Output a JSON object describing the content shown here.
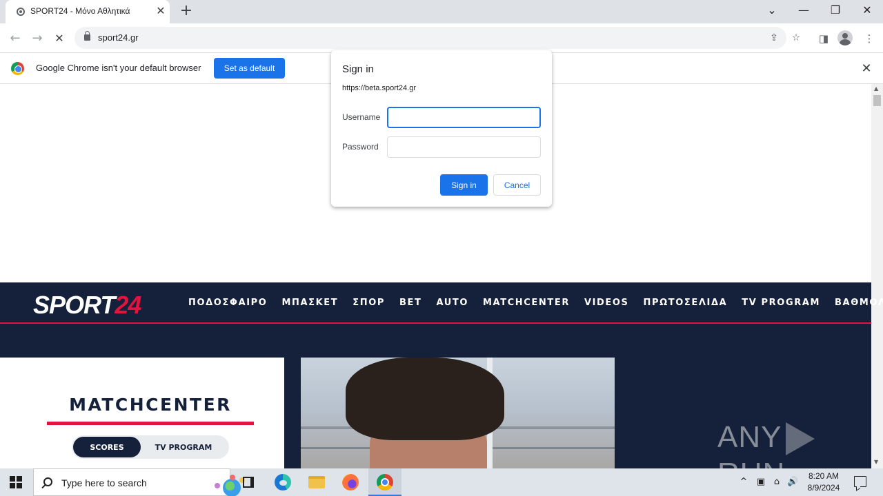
{
  "browser": {
    "tab": {
      "title": "SPORT24 - Μόνο Αθλητικά",
      "close": "✕"
    },
    "new_tab": "+",
    "window_controls": {
      "list": "⌄",
      "minimize": "—",
      "restore": "❐",
      "close": "✕"
    },
    "nav": {
      "back": "←",
      "forward": "→",
      "stop": "✕"
    },
    "url": "sport24.gr",
    "icons": {
      "share": "⇪",
      "star": "☆",
      "sidepanel": "◨",
      "menu": "⋮"
    }
  },
  "infobar": {
    "message": "Google Chrome isn't your default browser",
    "button": "Set as default",
    "close": "✕"
  },
  "dialog": {
    "title": "Sign in",
    "origin": "https://beta.sport24.gr",
    "username_label": "Username",
    "username_value": "",
    "password_label": "Password",
    "password_value": "",
    "signin": "Sign in",
    "cancel": "Cancel"
  },
  "site": {
    "logo_a": "SPORT",
    "logo_b": "24",
    "nav": [
      "ΠΟΔΟΣΦΑΙΡΟ",
      "ΜΠΑΣΚΕΤ",
      "ΣΠΟΡ",
      "BET",
      "AUTO",
      "MATCHCENTER",
      "VIDEOS",
      "ΠΡΩΤΟΣΕΛΙΔΑ",
      "TV PROGRAM",
      "ΒΑΘΜΟΛΟΓΙΕΣ"
    ],
    "matchcenter": {
      "title": "MATCHCENTER",
      "scores": "SCORES",
      "tv": "TV PROGRAM"
    },
    "colors": {
      "navy": "#15213a",
      "red": "#e0143c"
    }
  },
  "watermark": {
    "left": "ANY",
    "right": "RUN"
  },
  "scrollbar": {
    "up": "▲",
    "down": "▼"
  },
  "taskbar": {
    "search_placeholder": "Type here to search",
    "clock_time": "8:20 AM",
    "clock_date": "8/9/2024",
    "tray": {
      "chevron": "^",
      "network": "⌂",
      "volume": "🔊",
      "device": "▣"
    }
  }
}
